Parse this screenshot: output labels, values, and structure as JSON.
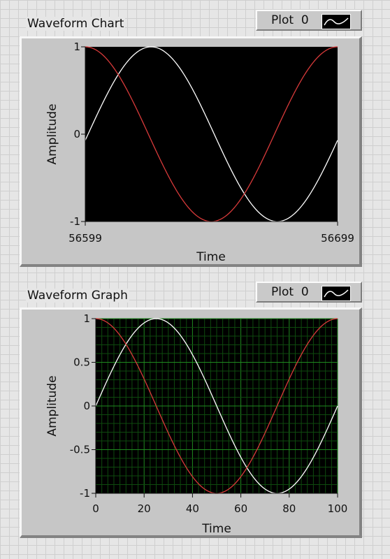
{
  "chart1": {
    "label": "Waveform Chart",
    "legend": {
      "label": "Plot",
      "index": "0"
    }
  },
  "chart2": {
    "label": "Waveform Graph",
    "legend": {
      "label": "Plot",
      "index": "0"
    }
  },
  "colors": {
    "plot_background_chart": "#000000",
    "plot_background_graph": "#000000",
    "grid_major": "#1f8a1f",
    "grid_minor": "#0e4a0e",
    "series_white": "#ffffff",
    "series_red": "#d83a3a"
  },
  "chart_data": [
    {
      "type": "line",
      "title": "Waveform Chart",
      "xlabel": "Time",
      "ylabel": "Amplitude",
      "xlim": [
        56599,
        56699
      ],
      "ylim": [
        -1,
        1
      ],
      "x_tick_labels": [
        "56599",
        "56699"
      ],
      "y_tick_labels": [
        "1",
        "0",
        "-1"
      ],
      "grid": false,
      "series": [
        {
          "color": "#ffffff",
          "x": [
            56599,
            56624,
            56649,
            56674,
            56699
          ],
          "y": [
            -0.07,
            1.0,
            0.07,
            -1.0,
            -0.07
          ],
          "function": "sine",
          "period": 100,
          "phase_deg": -4
        },
        {
          "color": "#d83a3a",
          "x": [
            56599,
            56624,
            56649,
            56674,
            56699
          ],
          "y": [
            1.0,
            0.0,
            -1.0,
            0.0,
            1.0
          ],
          "function": "cosine",
          "period": 100,
          "phase_deg": 0
        }
      ]
    },
    {
      "type": "line",
      "title": "Waveform Graph",
      "xlabel": "Time",
      "ylabel": "Amplitude",
      "xlim": [
        0,
        100
      ],
      "ylim": [
        -1,
        1
      ],
      "x_ticks": [
        0,
        20,
        40,
        60,
        80,
        100
      ],
      "y_ticks": [
        1,
        0.5,
        0,
        -0.5,
        -1
      ],
      "x_tick_labels": [
        "0",
        "20",
        "40",
        "60",
        "80",
        "100"
      ],
      "y_tick_labels": [
        "1",
        "0.5",
        "0",
        "-0.5",
        "-1"
      ],
      "grid": true,
      "series": [
        {
          "color": "#ffffff",
          "x": [
            0,
            25,
            50,
            75,
            100
          ],
          "y": [
            0.0,
            1.0,
            0.0,
            -1.0,
            0.0
          ],
          "function": "sine",
          "period": 100,
          "phase_deg": 0
        },
        {
          "color": "#d83a3a",
          "x": [
            0,
            25,
            50,
            75,
            100
          ],
          "y": [
            1.0,
            0.0,
            -1.0,
            0.0,
            1.0
          ],
          "function": "cosine",
          "period": 100,
          "phase_deg": 0
        }
      ]
    }
  ]
}
